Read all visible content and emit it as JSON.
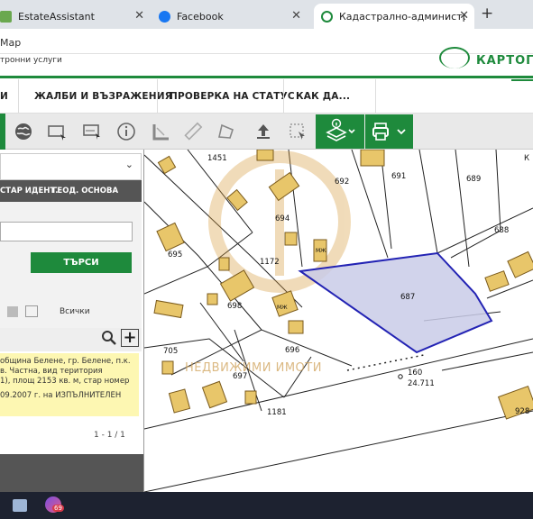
{
  "browser": {
    "tabs": [
      {
        "title": "EstateAssistant",
        "active": false
      },
      {
        "title": "Facebook",
        "active": false
      },
      {
        "title": "Кадастрално-административн",
        "active": true
      }
    ],
    "new_tab": "+",
    "address_fragment": "Map"
  },
  "header": {
    "left_text": "тронни услуги",
    "logo_text": "КАРТОГР"
  },
  "nav": {
    "items": [
      "И",
      "ЖАЛБИ И ВЪЗРАЖЕНИЯ",
      "ПРОВЕРКА НА СТАТУС",
      "КАК ДА..."
    ]
  },
  "toolbar": {
    "icons": [
      "globe-icon",
      "select-rect-icon",
      "select-poly-icon",
      "info-icon",
      "measure-icon",
      "ruler-icon",
      "area-icon",
      "upload-icon",
      "select-icon",
      "layers-icon",
      "print-icon"
    ]
  },
  "panel": {
    "tab_old_id": "СТАР ИДЕНТ.",
    "tab_geo": "ГЕОД. ОСНОВА",
    "search_button": "ТЪРСИ",
    "filter_all": "Всички",
    "result_lines": [
      "община Белене, гр. Белене, п.к.",
      "в. Частна, вид територия",
      "1), площ 2153 кв. м, стар номер",
      "09.2007 г. на ИЗПЪЛНИТЕЛЕН"
    ],
    "pager": "1 - 1 / 1"
  },
  "map": {
    "labels": {
      "p1451": "1451",
      "p692": "692",
      "p691": "691",
      "p689": "689",
      "p688": "688",
      "p694": "694",
      "p695": "695",
      "p1172": "1172",
      "p687": "687",
      "p698": "698",
      "p696": "696",
      "p705": "705",
      "p697": "697",
      "p1181": "1181",
      "p928": "928",
      "p160": "160",
      "elev": "24.711",
      "k": "К",
      "mzh": "МЖ"
    },
    "watermark": "НЕДВИЖИМИ ИМОТИ",
    "highlight_color": "#2323b4"
  },
  "taskbar": {
    "badge": "69"
  }
}
